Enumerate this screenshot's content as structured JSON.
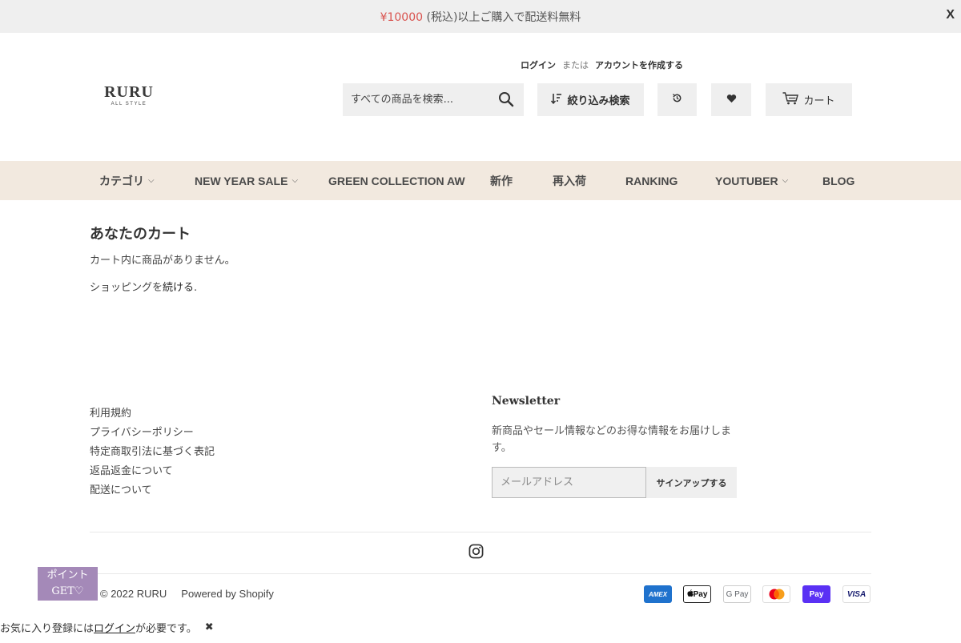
{
  "announcement": {
    "price": "¥10000",
    "text": " (税込)以上ご購入で配送料無料",
    "close_label": "X"
  },
  "logo": {
    "main": "RURU",
    "sub": "ALL STYLE"
  },
  "account": {
    "login": "ログイン",
    "or": "または",
    "create": "アカウントを作成する"
  },
  "search": {
    "placeholder": "すべての商品を検索..."
  },
  "header_buttons": {
    "filter": "絞り込み検索",
    "cart": "カート"
  },
  "nav": {
    "items": [
      {
        "label": "カテゴリ",
        "dropdown": "⌵"
      },
      {
        "label": "NEW YEAR SALE",
        "dropdown": "⌵"
      },
      {
        "label": "GREEN COLLECTION AW"
      },
      {
        "label": "新作"
      },
      {
        "label": "再入荷"
      },
      {
        "label": "RANKING"
      },
      {
        "label": "YOUTUBER",
        "dropdown": "⌵"
      },
      {
        "label": "BLOG"
      }
    ]
  },
  "main": {
    "title": "あなたのカート",
    "empty": "カート内に商品がありません。",
    "continue_prefix": "ショッピングを",
    "continue_link": "続ける",
    "continue_suffix": "."
  },
  "footer": {
    "links": [
      "利用規約",
      "プライバシーポリシー",
      "特定商取引法に基づく表記",
      "返品返金について",
      "配送について"
    ],
    "newsletter": {
      "title": "Newsletter",
      "desc": "新商品やセール情報などのお得な情報をお届けします。",
      "placeholder": "メールアドレス",
      "button": "サインアップする"
    },
    "copyright": "© 2022 RURU",
    "powered": "Powered by Shopify",
    "payments": {
      "amex": "AMEX",
      "apple": "Pay",
      "gpay": "G Pay",
      "shop": "Pay",
      "visa": "VISA"
    }
  },
  "point_badge": {
    "line1": "ポイント",
    "line2": "GET♡"
  },
  "fav_notice": {
    "prefix": "お気に入り登録には",
    "link": "ログイン",
    "suffix": "が必要です。",
    "close": "✖"
  },
  "colors": {
    "nav_bg": "#f2e9df",
    "announce_price": "#d9534f",
    "point_badge": "#a489b8"
  }
}
